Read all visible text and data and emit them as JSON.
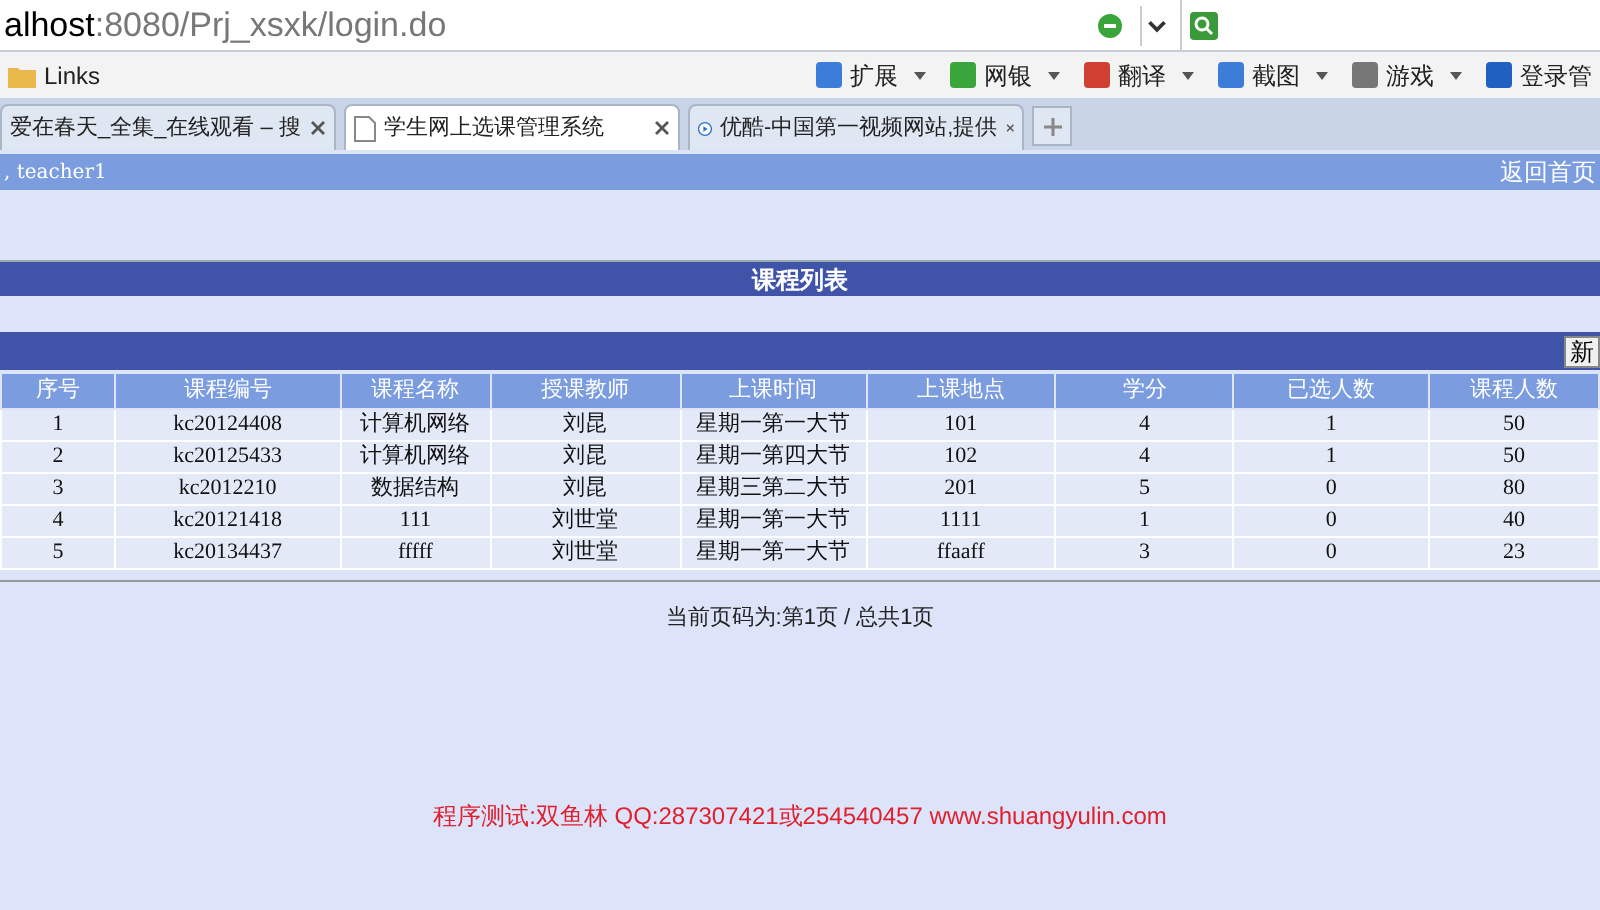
{
  "browser": {
    "address": {
      "host": "alhost",
      "rest": ":8080/Prj_xsxk/login.do"
    },
    "bookmarks": [
      {
        "label": "Links"
      }
    ],
    "toolbar": [
      {
        "label": "扩展"
      },
      {
        "label": "网银"
      },
      {
        "label": "翻译"
      },
      {
        "label": "截图"
      },
      {
        "label": "游戏"
      },
      {
        "label": "登录管"
      }
    ],
    "tabs": [
      {
        "label": "爱在春天_全集_在线观看 – 搜",
        "selected": false
      },
      {
        "label": "学生网上选课管理系统",
        "selected": true
      },
      {
        "label": "优酷-中国第一视频网站,提供",
        "selected": false
      }
    ]
  },
  "user_bar": {
    "user": ", teacher1",
    "link": "返回首页"
  },
  "panel_title": "课程列表",
  "add_button": "新",
  "table": {
    "columns": [
      "序号",
      "课程编号",
      "课程名称",
      "授课教师",
      "上课时间",
      "上课地点",
      "学分",
      "已选人数",
      "课程人数"
    ],
    "rows": [
      [
        "1",
        "kc20124408",
        "计算机网络",
        "刘昆",
        "星期一第一大节",
        "101",
        "4",
        "1",
        "50"
      ],
      [
        "2",
        "kc20125433",
        "计算机网络",
        "刘昆",
        "星期一第四大节",
        "102",
        "4",
        "1",
        "50"
      ],
      [
        "3",
        "kc2012210",
        "数据结构",
        "刘昆",
        "星期三第二大节",
        "201",
        "5",
        "0",
        "80"
      ],
      [
        "4",
        "kc20121418",
        "111",
        "刘世堂",
        "星期一第一大节",
        "1111",
        "1",
        "0",
        "40"
      ],
      [
        "5",
        "kc20134437",
        "fffff",
        "刘世堂",
        "星期一第一大节",
        "ffaaff",
        "3",
        "0",
        "23"
      ]
    ]
  },
  "pagination": "当前页码为:第1页 / 总共1页",
  "footer": "程序测试:双鱼林 QQ:287307421或254540457 www.shuangyulin.com"
}
